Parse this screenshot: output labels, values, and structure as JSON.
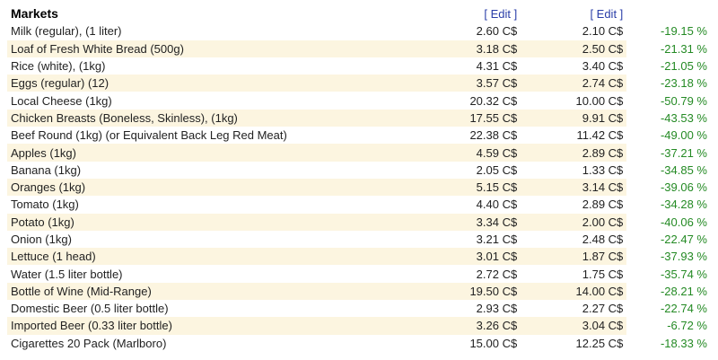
{
  "section": {
    "title": "Markets",
    "edit_label_1": "[ Edit ]",
    "edit_label_2": "[ Edit ]"
  },
  "colors": {
    "row_alt": "#fcf5e0",
    "edit_link": "#2a3ea8",
    "pct_green": "#248a24"
  },
  "items": [
    {
      "name": "Milk (regular), (1 liter)",
      "price_a": "2.60 C$",
      "price_b": "2.10 C$",
      "change": "-19.15 %"
    },
    {
      "name": "Loaf of Fresh White Bread (500g)",
      "price_a": "3.18 C$",
      "price_b": "2.50 C$",
      "change": "-21.31 %"
    },
    {
      "name": "Rice (white), (1kg)",
      "price_a": "4.31 C$",
      "price_b": "3.40 C$",
      "change": "-21.05 %"
    },
    {
      "name": "Eggs (regular) (12)",
      "price_a": "3.57 C$",
      "price_b": "2.74 C$",
      "change": "-23.18 %"
    },
    {
      "name": "Local Cheese (1kg)",
      "price_a": "20.32 C$",
      "price_b": "10.00 C$",
      "change": "-50.79 %"
    },
    {
      "name": "Chicken Breasts (Boneless, Skinless), (1kg)",
      "price_a": "17.55 C$",
      "price_b": "9.91 C$",
      "change": "-43.53 %"
    },
    {
      "name": "Beef Round (1kg) (or Equivalent Back Leg Red Meat)",
      "price_a": "22.38 C$",
      "price_b": "11.42 C$",
      "change": "-49.00 %"
    },
    {
      "name": "Apples (1kg)",
      "price_a": "4.59 C$",
      "price_b": "2.89 C$",
      "change": "-37.21 %"
    },
    {
      "name": "Banana (1kg)",
      "price_a": "2.05 C$",
      "price_b": "1.33 C$",
      "change": "-34.85 %"
    },
    {
      "name": "Oranges (1kg)",
      "price_a": "5.15 C$",
      "price_b": "3.14 C$",
      "change": "-39.06 %"
    },
    {
      "name": "Tomato (1kg)",
      "price_a": "4.40 C$",
      "price_b": "2.89 C$",
      "change": "-34.28 %"
    },
    {
      "name": "Potato (1kg)",
      "price_a": "3.34 C$",
      "price_b": "2.00 C$",
      "change": "-40.06 %"
    },
    {
      "name": "Onion (1kg)",
      "price_a": "3.21 C$",
      "price_b": "2.48 C$",
      "change": "-22.47 %"
    },
    {
      "name": "Lettuce (1 head)",
      "price_a": "3.01 C$",
      "price_b": "1.87 C$",
      "change": "-37.93 %"
    },
    {
      "name": "Water (1.5 liter bottle)",
      "price_a": "2.72 C$",
      "price_b": "1.75 C$",
      "change": "-35.74 %"
    },
    {
      "name": "Bottle of Wine (Mid-Range)",
      "price_a": "19.50 C$",
      "price_b": "14.00 C$",
      "change": "-28.21 %"
    },
    {
      "name": "Domestic Beer (0.5 liter bottle)",
      "price_a": "2.93 C$",
      "price_b": "2.27 C$",
      "change": "-22.74 %"
    },
    {
      "name": "Imported Beer (0.33 liter bottle)",
      "price_a": "3.26 C$",
      "price_b": "3.04 C$",
      "change": "-6.72 %"
    },
    {
      "name": "Cigarettes 20 Pack (Marlboro)",
      "price_a": "15.00 C$",
      "price_b": "12.25 C$",
      "change": "-18.33 %"
    }
  ]
}
